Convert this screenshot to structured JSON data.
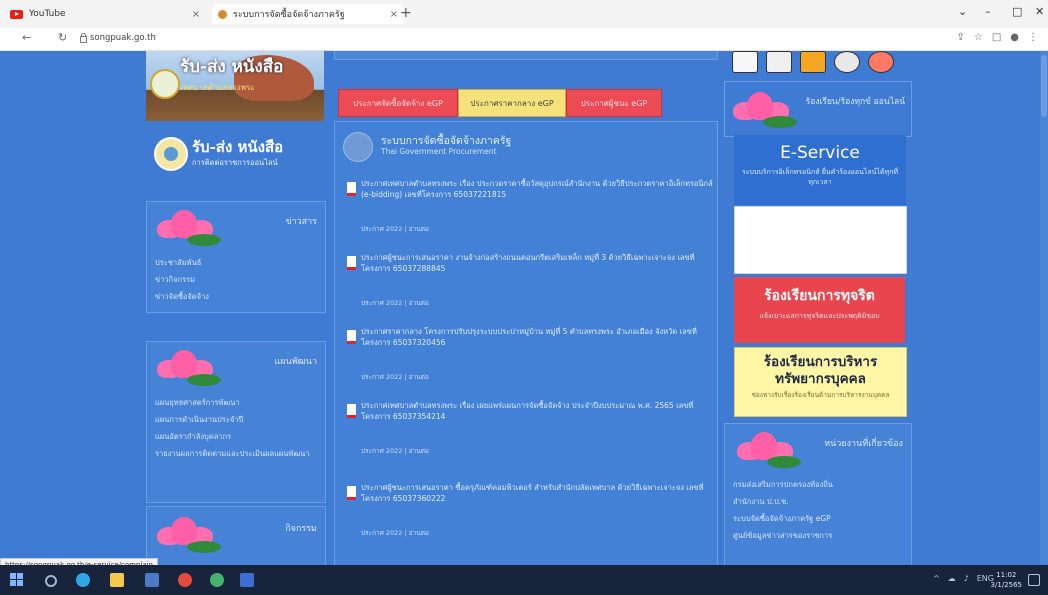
{
  "browser": {
    "tabs": [
      {
        "label": "YouTube",
        "close": "×"
      },
      {
        "label": "ระบบการจัดซื้อจัดจ้างภาครัฐ",
        "close": "×"
      }
    ],
    "new_tab": "+",
    "window_controls": {
      "chevron": "⌄",
      "minimize": "–",
      "maximize": "□",
      "close": "✕"
    },
    "nav": {
      "back": "←",
      "reload": "↻"
    },
    "url": "songpuak.go.th",
    "status_link": "https://songpuak.go.th/e-service/complain"
  },
  "left": {
    "banner": {
      "title": "รับ-ส่ง หนังสือ",
      "subtitle": "เทศบาลตำบลทรงพระ"
    },
    "logo": {
      "title": "รับ-ส่ง หนังสือ",
      "subtitle": "การติดต่อราชการออนไลน์"
    },
    "boxes": [
      {
        "heading": "ข่าวสาร",
        "items": [
          "ประชาสัมพันธ์",
          "ข่าวกิจกรรม",
          "ข่าวจัดซื้อจัดจ้าง"
        ]
      },
      {
        "heading": "แผนพัฒนา",
        "items": [
          "แผนยุทธศาสตร์การพัฒนา",
          "แผนการดำเนินงานประจำปี",
          "แผนอัตรากำลังบุคลากร",
          "รายงานผลการติดตามและประเมินผลแผนพัฒนา"
        ]
      },
      {
        "heading": "กิจกรรม",
        "items": []
      }
    ]
  },
  "middle": {
    "buttons": [
      "ประกาศจัดซื้อจัดจ้าง eGP",
      "ประกาศราคากลาง eGP",
      "ประกาศผู้ชนะ eGP"
    ],
    "news": {
      "title": "ระบบการจัดซื้อจัดจ้างภาครัฐ",
      "subtitle": "Thai Government Procurement",
      "items": [
        {
          "text": "ประกาศเทศบาลตำบลทรงพระ เรื่อง ประกวดราคาซื้อวัสดุอุปกรณ์สำนักงาน ด้วยวิธีประกวดราคาอิเล็กทรอนิกส์ (e-bidding) เลขที่โครงการ 65037221815",
          "meta": "ประกาศ 2022 | อ่านต่อ"
        },
        {
          "text": "ประกาศผู้ชนะการเสนอราคา งานจ้างก่อสร้างถนนคอนกรีตเสริมเหล็ก หมู่ที่ 3 ด้วยวิธีเฉพาะเจาะจง เลขที่โครงการ 65037288845",
          "meta": "ประกาศ 2022 | อ่านต่อ"
        },
        {
          "text": "ประกาศราคากลาง โครงการปรับปรุงระบบประปาหมู่บ้าน หมู่ที่ 5 ตำบลทรงพระ อำเภอเมือง จังหวัด เลขที่โครงการ 65037320456",
          "meta": "ประกาศ 2022 | อ่านต่อ"
        },
        {
          "text": "ประกาศเทศบาลตำบลทรงพระ เรื่อง เผยแพร่แผนการจัดซื้อจัดจ้าง ประจำปีงบประมาณ พ.ศ. 2565 เลขที่โครงการ 65037354214",
          "meta": "ประกาศ 2022 | อ่านต่อ"
        },
        {
          "text": "ประกาศผู้ชนะการเสนอราคา ซื้อครุภัณฑ์คอมพิวเตอร์ สำหรับสำนักปลัดเทศบาล ด้วยวิธีเฉพาะเจาะจง เลขที่โครงการ 65037360222",
          "meta": "ประกาศ 2022 | อ่านต่อ"
        }
      ]
    }
  },
  "right": {
    "header": "ร้องเรียน/ร้องทุกข์ ออนไลน์",
    "eservice": {
      "title": "E-Service",
      "desc": "ระบบบริการอิเล็กทรอนิกส์ ยื่นคำร้องออนไลน์ได้ทุกที่ทุกเวลา"
    },
    "red_panel": {
      "title": "ร้องเรียนการทุจริต",
      "desc": "แจ้งเบาะแสการทุจริตและประพฤติมิชอบ"
    },
    "yellow_panel": {
      "title_line1": "ร้องเรียนการบริหาร",
      "title_line2": "ทรัพยากรบุคคล",
      "desc": "ช่องทางรับเรื่องร้องเรียนด้านการบริหารงานบุคคล"
    },
    "box": {
      "heading": "หน่วยงานที่เกี่ยวข้อง",
      "items": [
        "กรมส่งเสริมการปกครองท้องถิ่น",
        "สำนักงาน ป.ป.ช.",
        "ระบบจัดซื้อจัดจ้างภาครัฐ eGP",
        "ศูนย์ข้อมูลข่าวสารของราชการ"
      ]
    }
  },
  "taskbar": {
    "tray": [
      "^",
      "☁",
      "♪",
      "ENG"
    ],
    "time": "11:02",
    "date": "3/1/2565"
  }
}
